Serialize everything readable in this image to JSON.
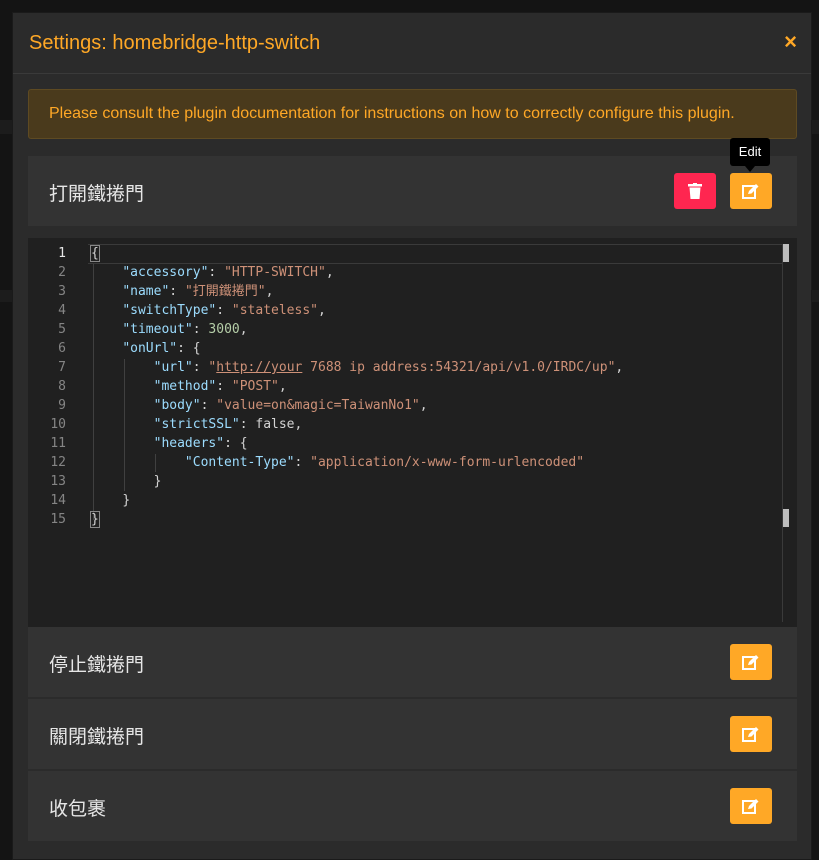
{
  "modal": {
    "title": "Settings: homebridge-http-switch",
    "close_icon": "×"
  },
  "warning": {
    "text": "Please consult the plugin documentation for instructions on how to correctly configure this plugin."
  },
  "tooltip": {
    "text": "Edit"
  },
  "accessories": [
    {
      "title": "打開鐵捲門"
    },
    {
      "title": "停止鐵捲門"
    },
    {
      "title": "關閉鐵捲門"
    },
    {
      "title": "收包裹"
    }
  ],
  "editor": {
    "line_numbers": [
      "1",
      "2",
      "3",
      "4",
      "5",
      "6",
      "7",
      "8",
      "9",
      "10",
      "11",
      "12",
      "13",
      "14",
      "15"
    ],
    "lines": {
      "l1": "{",
      "l2_key": "\"accessory\"",
      "l2_val": "\"HTTP-SWITCH\"",
      "l3_key": "\"name\"",
      "l3_val": "\"打開鐵捲門\"",
      "l4_key": "\"switchType\"",
      "l4_val": "\"stateless\"",
      "l5_key": "\"timeout\"",
      "l5_val": "3000",
      "l6_key": "\"onUrl\"",
      "l7_key": "\"url\"",
      "l7_val_a": "\"",
      "l7_val_b": "http://your",
      "l7_val_c": " 7688 ip address:54321/api/v1.0/IRDC/up\"",
      "l8_key": "\"method\"",
      "l8_val": "\"POST\"",
      "l9_key": "\"body\"",
      "l9_val": "\"value=on&magic=TaiwanNo1\"",
      "l10_key": "\"strictSSL\"",
      "l10_val": "false",
      "l11_key": "\"headers\"",
      "l12_key": "\"Content-Type\"",
      "l12_val": "\"application/x-www-form-urlencoded\"",
      "l13": "}",
      "l14": "}",
      "l15": "}"
    }
  },
  "colors": {
    "accent": "#ffa826",
    "danger": "#ff2650",
    "panel": "#333333",
    "editor_bg": "#202020"
  },
  "icons": {
    "edit": "edit-icon",
    "delete": "trash-icon"
  }
}
